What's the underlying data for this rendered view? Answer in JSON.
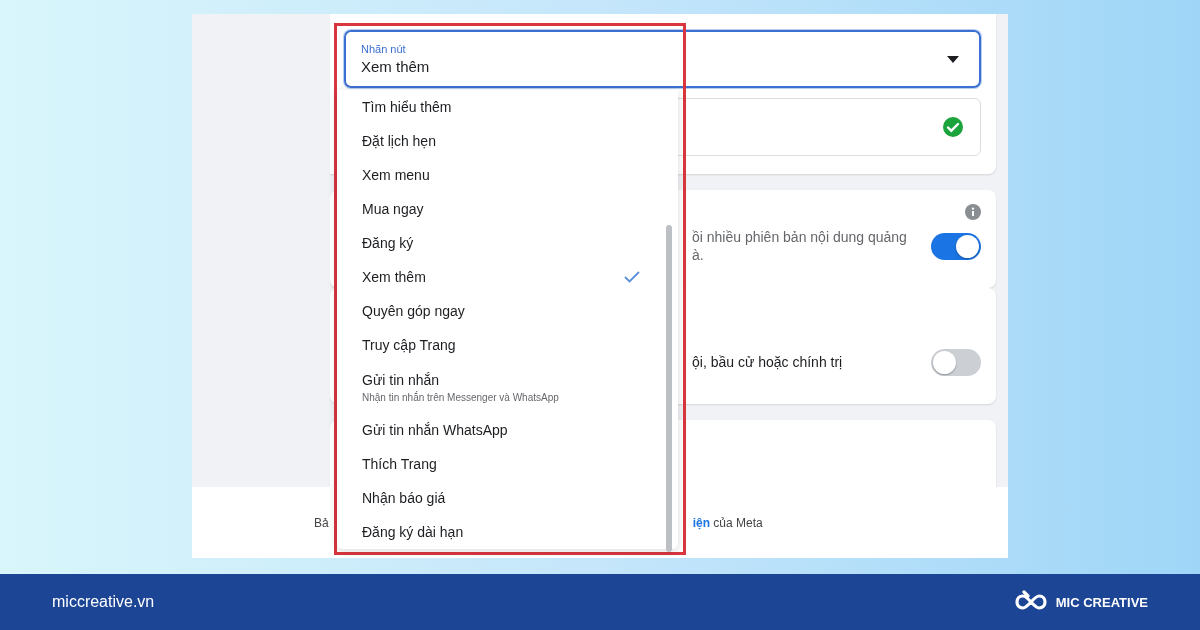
{
  "button_field": {
    "label": "Nhãn nút",
    "value": "Xem thêm"
  },
  "dropdown": {
    "options": [
      {
        "label": "Tìm hiểu thêm",
        "selected": false
      },
      {
        "label": "Đặt lịch hẹn",
        "selected": false
      },
      {
        "label": "Xem menu",
        "selected": false
      },
      {
        "label": "Mua ngay",
        "selected": false
      },
      {
        "label": "Đăng ký",
        "selected": false
      },
      {
        "label": "Xem thêm",
        "selected": true
      },
      {
        "label": "Quyên góp ngay",
        "selected": false
      },
      {
        "label": "Truy cập Trang",
        "selected": false
      },
      {
        "label": "Gửi tin nhắn",
        "sublabel": "Nhận tin nhắn trên Messenger và WhatsApp",
        "selected": false
      },
      {
        "label": "Gửi tin nhắn WhatsApp",
        "selected": false
      },
      {
        "label": "Thích Trang",
        "selected": false
      },
      {
        "label": "Nhận báo giá",
        "selected": false
      },
      {
        "label": "Đăng ký dài hạn",
        "selected": false
      }
    ]
  },
  "sections": [
    {
      "info_icon": true,
      "description": [
        "ồi nhiều phiên bản nội dung quảng",
        "à."
      ],
      "on": true
    },
    {
      "info_icon": false,
      "description": [
        "ội, bầu cử hoặc chính trị"
      ],
      "on": false
    }
  ],
  "footer": {
    "left_text": "Bả",
    "link": "iện",
    "text_end": " của Meta"
  },
  "brand_bar": {
    "site": "miccreative.vn",
    "brand": "MIC CREATIVE"
  }
}
